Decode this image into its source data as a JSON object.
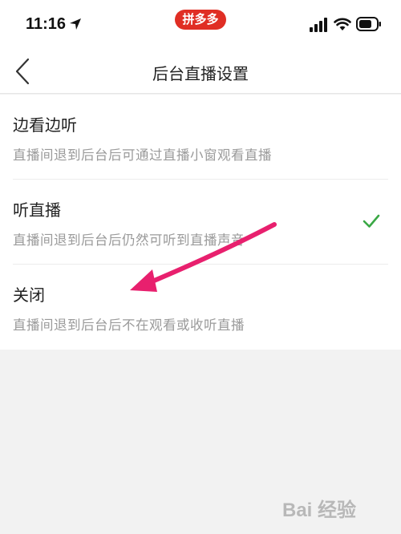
{
  "status_bar": {
    "time": "11:16",
    "app_badge": "拼多多",
    "icons": [
      "location-arrow-icon",
      "cellular-signal-icon",
      "wifi-icon",
      "battery-icon"
    ]
  },
  "nav": {
    "title": "后台直播设置",
    "back_icon": "chevron-left-icon"
  },
  "options": [
    {
      "title": "边看边听",
      "description": "直播间退到后台后可通过直播小窗观看直播",
      "selected": false
    },
    {
      "title": "听直播",
      "description": "直播间退到后台后仍然可听到直播声音",
      "selected": true
    },
    {
      "title": "关闭",
      "description": "直播间退到后台后不在观看或收听直播",
      "selected": false
    }
  ],
  "colors": {
    "brand_red": "#e02e24",
    "check_green": "#3aa845",
    "annotation_pink": "#e8206e"
  },
  "watermark": {
    "text": "Bai 经验"
  }
}
